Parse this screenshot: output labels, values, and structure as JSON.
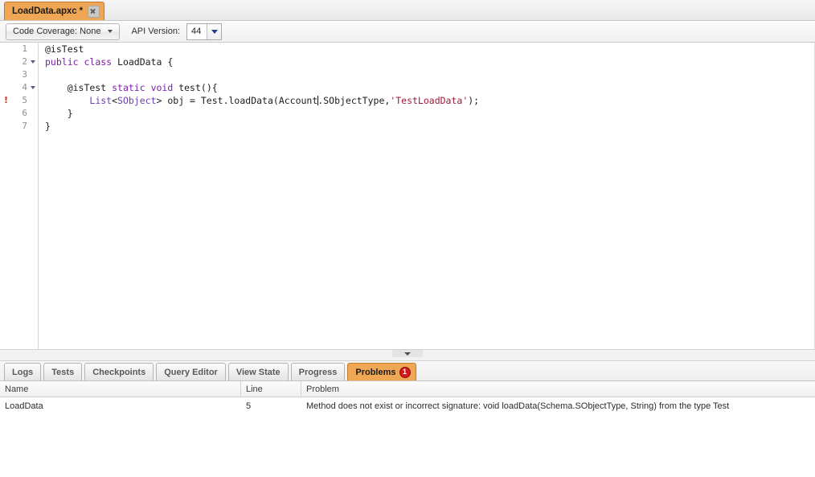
{
  "window": {
    "app": "Force.com IDE - Apex Code Editor"
  },
  "file_tab": {
    "label": "LoadData.apxc *",
    "close_icon": "close-icon",
    "active": true
  },
  "toolbar": {
    "code_coverage_label": "Code Coverage: None",
    "code_coverage_caret": "chevron-down-icon",
    "api_version_label": "API Version:",
    "api_version_value": "44",
    "api_version_caret": "chevron-down-icon"
  },
  "editor": {
    "lines": [
      {
        "number": "1",
        "fold": false,
        "error": false,
        "tokens": [
          {
            "t": "@isTest",
            "c": "k-anno"
          }
        ]
      },
      {
        "number": "2",
        "fold": true,
        "error": false,
        "tokens": [
          {
            "t": "public",
            "c": "k-kw"
          },
          {
            "t": " ",
            "c": "k-plain"
          },
          {
            "t": "class",
            "c": "k-kw"
          },
          {
            "t": " LoadData {",
            "c": "k-plain"
          }
        ]
      },
      {
        "number": "3",
        "fold": false,
        "error": false,
        "tokens": []
      },
      {
        "number": "4",
        "fold": true,
        "error": false,
        "tokens": [
          {
            "t": "    @isTest ",
            "c": "k-anno"
          },
          {
            "t": "static",
            "c": "k-kw"
          },
          {
            "t": " ",
            "c": "k-plain"
          },
          {
            "t": "void",
            "c": "k-kw"
          },
          {
            "t": " test(){",
            "c": "k-plain"
          }
        ]
      },
      {
        "number": "5",
        "fold": false,
        "error": true,
        "error_marker": "error-exclamation-icon",
        "tokens": [
          {
            "t": "        ",
            "c": "k-plain"
          },
          {
            "t": "List",
            "c": "k-type"
          },
          {
            "t": "<",
            "c": "k-plain"
          },
          {
            "t": "SObject",
            "c": "k-type"
          },
          {
            "t": "> obj = Test.loadData(Account",
            "c": "k-plain"
          },
          {
            "t": "|CARET|",
            "c": "k-plain"
          },
          {
            "t": ".SObjectType,",
            "c": "k-plain"
          },
          {
            "t": "'TestLoadData'",
            "c": "k-str"
          },
          {
            "t": ");",
            "c": "k-plain"
          }
        ]
      },
      {
        "number": "6",
        "fold": false,
        "error": false,
        "tokens": [
          {
            "t": "    }",
            "c": "k-plain"
          }
        ]
      },
      {
        "number": "7",
        "fold": false,
        "error": false,
        "tokens": [
          {
            "t": "}",
            "c": "k-plain"
          }
        ]
      }
    ]
  },
  "splitter": {
    "collapse_icon": "chevron-down-icon"
  },
  "bottom_tabs": [
    {
      "label": "Logs",
      "active": false,
      "badge": null
    },
    {
      "label": "Tests",
      "active": false,
      "badge": null
    },
    {
      "label": "Checkpoints",
      "active": false,
      "badge": null
    },
    {
      "label": "Query Editor",
      "active": false,
      "badge": null
    },
    {
      "label": "View State",
      "active": false,
      "badge": null
    },
    {
      "label": "Progress",
      "active": false,
      "badge": null
    },
    {
      "label": "Problems",
      "active": true,
      "badge": "1"
    }
  ],
  "problems": {
    "columns": [
      "Name",
      "Line",
      "Problem"
    ],
    "rows": [
      {
        "name": "LoadData",
        "line": "5",
        "problem": "Method does not exist or incorrect signature: void loadData(Schema.SObjectType, String) from the type Test"
      }
    ]
  },
  "colors": {
    "accent_orange": "#f0a755",
    "accent_orange_border": "#c07a2c",
    "badge_red": "#cf1b1b",
    "keyword_purple": "#7a1fa2",
    "type_purple": "#6a3fb5",
    "string_maroon": "#9b1c38",
    "error_red": "#e02020"
  }
}
